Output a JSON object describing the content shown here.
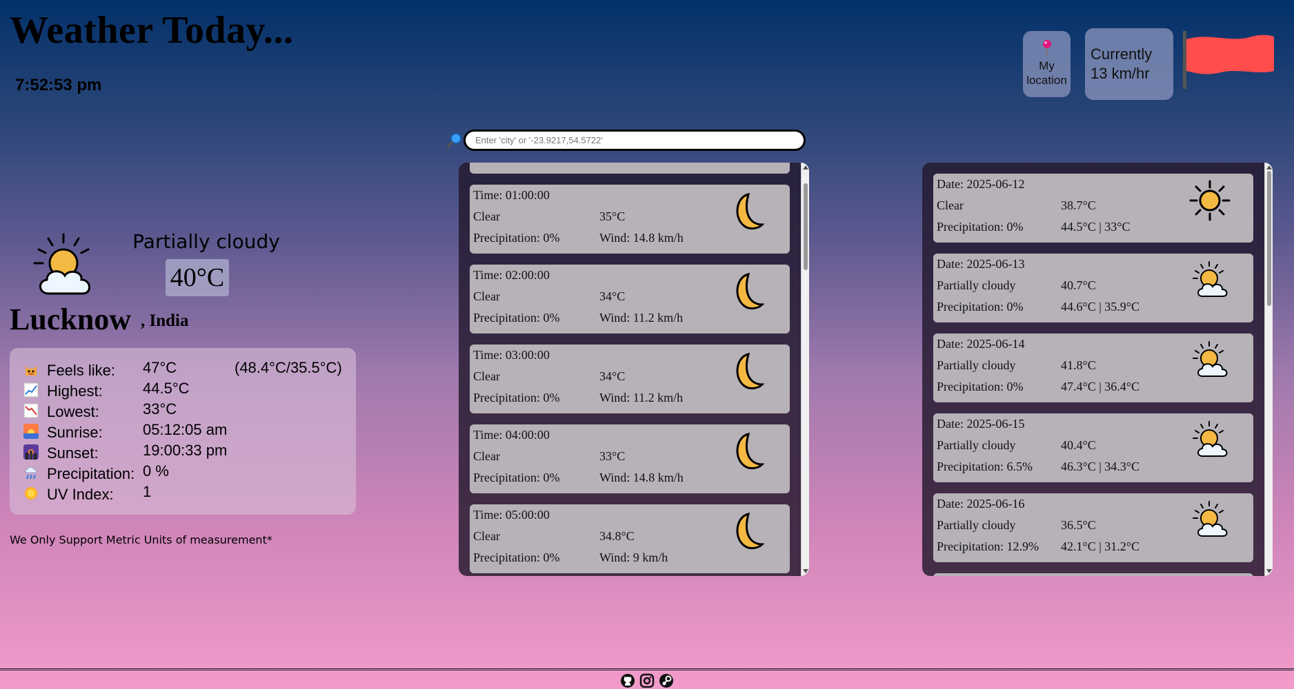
{
  "header": {
    "title": "Weather Today...",
    "clock": "7:52:53 pm",
    "location_button_label": "My location",
    "wind_label": "Currently",
    "wind_value": "13 km/hr"
  },
  "search": {
    "placeholder": "Enter 'city' or '-23.9217,54.5722'"
  },
  "current": {
    "condition": "Partially cloudy",
    "temperature": "40°C",
    "city": "Lucknow",
    "country": ", India",
    "details": [
      {
        "label": "Feels like:",
        "value": "47°C",
        "extra": "(48.4°C/35.5°C)",
        "icon": "cat-icon"
      },
      {
        "label": "Highest:",
        "value": "44.5°C",
        "extra": "",
        "icon": "trend-up-icon"
      },
      {
        "label": "Lowest:",
        "value": "33°C",
        "extra": "",
        "icon": "trend-down-icon"
      },
      {
        "label": "Sunrise:",
        "value": "05:12:05 am",
        "extra": "",
        "icon": "sunrise-icon"
      },
      {
        "label": "Sunset:",
        "value": "19:00:33 pm",
        "extra": "",
        "icon": "sunset-icon"
      },
      {
        "label": "Precipitation:",
        "value": "0 %",
        "extra": "",
        "icon": "rain-cloud-icon"
      },
      {
        "label": "UV Index:",
        "value": "1",
        "extra": "",
        "icon": "sun-small-icon"
      }
    ],
    "note": "We Only Support Metric Units of measurement*"
  },
  "hourly": [
    {
      "time": "Time: 01:00:00",
      "cond": "Clear",
      "temp": "35°C",
      "precip": "Precipitation: 0%",
      "wind": "Wind: 14.8 km/h",
      "icon": "moon-icon"
    },
    {
      "time": "Time: 02:00:00",
      "cond": "Clear",
      "temp": "34°C",
      "precip": "Precipitation: 0%",
      "wind": "Wind: 11.2 km/h",
      "icon": "moon-icon"
    },
    {
      "time": "Time: 03:00:00",
      "cond": "Clear",
      "temp": "34°C",
      "precip": "Precipitation: 0%",
      "wind": "Wind: 11.2 km/h",
      "icon": "moon-icon"
    },
    {
      "time": "Time: 04:00:00",
      "cond": "Clear",
      "temp": "33°C",
      "precip": "Precipitation: 0%",
      "wind": "Wind: 14.8 km/h",
      "icon": "moon-icon"
    },
    {
      "time": "Time: 05:00:00",
      "cond": "Clear",
      "temp": "34.8°C",
      "precip": "Precipitation: 0%",
      "wind": "Wind: 9 km/h",
      "icon": "moon-icon"
    }
  ],
  "daily": [
    {
      "date": "Date: 2025-06-12",
      "cond": "Clear",
      "temp": "38.7°C",
      "precip": "Precipitation: 0%",
      "range": "44.5°C | 33°C",
      "icon": "sun-icon"
    },
    {
      "date": "Date: 2025-06-13",
      "cond": "Partially cloudy",
      "temp": "40.7°C",
      "precip": "Precipitation: 0%",
      "range": "44.6°C | 35.9°C",
      "icon": "partly-cloudy-icon"
    },
    {
      "date": "Date: 2025-06-14",
      "cond": "Partially cloudy",
      "temp": "41.8°C",
      "precip": "Precipitation: 0%",
      "range": "47.4°C | 36.4°C",
      "icon": "partly-cloudy-icon"
    },
    {
      "date": "Date: 2025-06-15",
      "cond": "Partially cloudy",
      "temp": "40.4°C",
      "precip": "Precipitation: 6.5%",
      "range": "46.3°C | 34.3°C",
      "icon": "partly-cloudy-icon"
    },
    {
      "date": "Date: 2025-06-16",
      "cond": "Partially cloudy",
      "temp": "36.5°C",
      "precip": "Precipitation: 12.9%",
      "range": "42.1°C | 31.2°C",
      "icon": "partly-cloudy-icon"
    }
  ],
  "footer": {
    "icons": [
      "github-icon",
      "instagram-icon",
      "steam-icon"
    ]
  },
  "colors": {
    "flag": "#ff4d4d",
    "moon": "#f4b942",
    "sun": "#f4b942"
  }
}
